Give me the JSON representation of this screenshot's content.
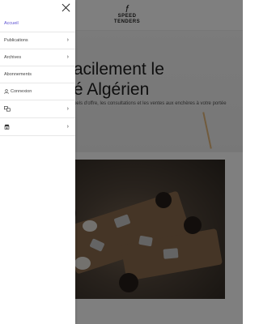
{
  "logo": {
    "mark": "𝑓",
    "line1": "SPEED",
    "line2": "TENDERS"
  },
  "hero": {
    "title_line1": "vre facilement le",
    "title_line2": "arché Algérien",
    "subtitle": "s les appels d'offre, les consultations et les ventes aux enchères à votre portée"
  },
  "drawer": {
    "close_icon": "close-icon",
    "items": [
      {
        "label": "Accueil",
        "active": true,
        "has_chevron": false
      },
      {
        "label": "Publications",
        "active": false,
        "has_chevron": true
      },
      {
        "label": "Archives",
        "active": false,
        "has_chevron": true
      },
      {
        "label": "Abonnements",
        "active": false,
        "has_chevron": false
      },
      {
        "label": "Connexion",
        "icon": "user-icon",
        "active": false,
        "has_chevron": false
      },
      {
        "label": "",
        "icon": "language-icon",
        "active": false,
        "has_chevron": true
      },
      {
        "label": "",
        "icon": "shop-icon",
        "active": false,
        "has_chevron": true
      }
    ],
    "chevron": "›"
  },
  "colors": {
    "accent": "#5a4fd1",
    "overlay": "rgba(0,0,0,0.5)"
  }
}
